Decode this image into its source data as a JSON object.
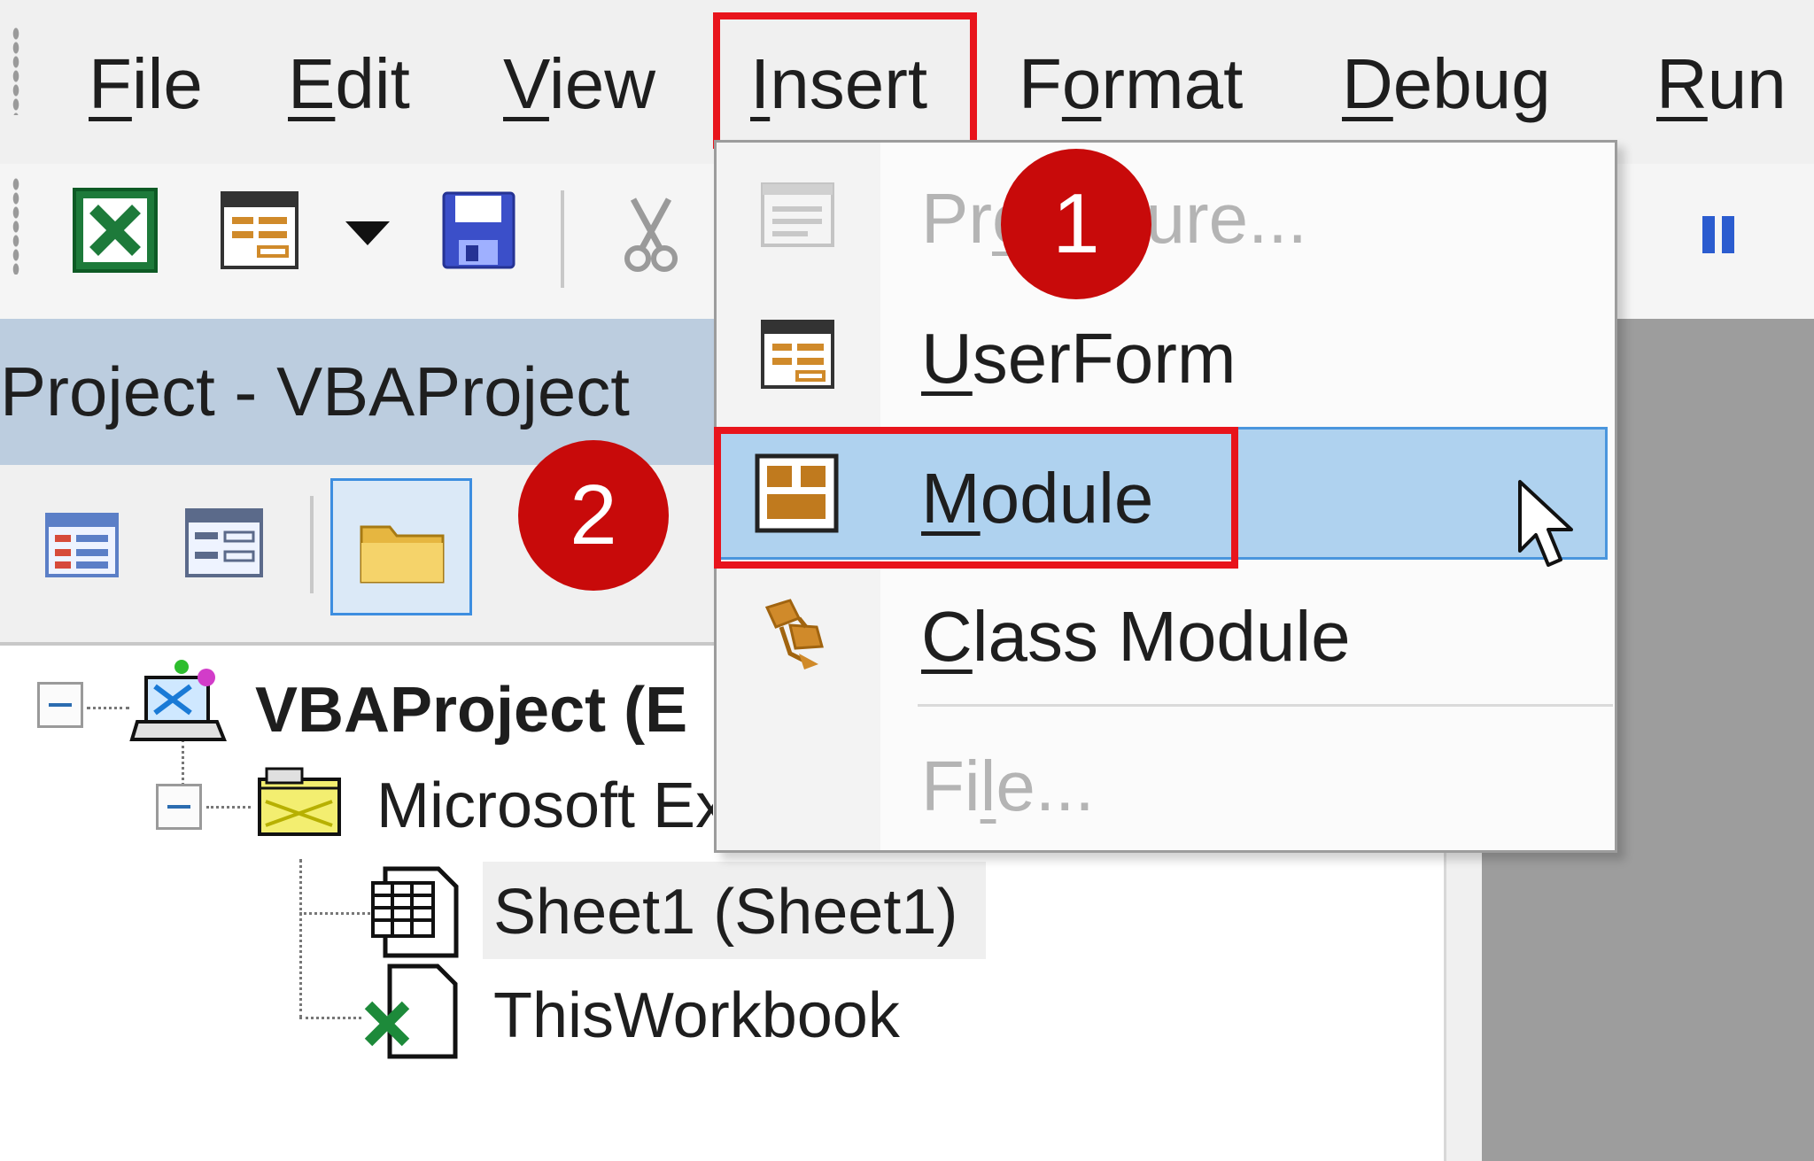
{
  "menubar": {
    "items": [
      {
        "prefix": "",
        "mnemonic": "F",
        "suffix": "ile"
      },
      {
        "prefix": "",
        "mnemonic": "E",
        "suffix": "dit"
      },
      {
        "prefix": "",
        "mnemonic": "V",
        "suffix": "iew"
      },
      {
        "prefix": "",
        "mnemonic": "I",
        "suffix": "nsert"
      },
      {
        "prefix": "F",
        "mnemonic": "o",
        "suffix": "rmat"
      },
      {
        "prefix": "",
        "mnemonic": "D",
        "suffix": "ebug"
      },
      {
        "prefix": "",
        "mnemonic": "R",
        "suffix": "un"
      }
    ]
  },
  "toolbar": {
    "icons": [
      "excel-icon",
      "userform-icon",
      "dropdown-arrow-icon",
      "save-icon",
      "cut-icon",
      "break-icon"
    ]
  },
  "project_explorer": {
    "title": "Project - VBAProject",
    "buttons": [
      "view-code-icon",
      "view-object-icon",
      "toggle-folders-icon"
    ],
    "tree": {
      "root": "VBAProject (E",
      "folder": "Microsoft Ex",
      "sheet": "Sheet1 (Sheet1)",
      "workbook": "ThisWorkbook"
    }
  },
  "insert_menu": {
    "items": [
      {
        "pre": "Pr",
        "mn": "o",
        "post": "cedure...",
        "visible": "Pro   ure...",
        "enabled": false
      },
      {
        "pre": "",
        "mn": "U",
        "post": "serForm",
        "enabled": true
      },
      {
        "pre": "",
        "mn": "M",
        "post": "odule",
        "enabled": true,
        "highlighted": true
      },
      {
        "pre": "",
        "mn": "C",
        "post": "lass Module",
        "enabled": true
      },
      {
        "pre": "Fi",
        "mn": "l",
        "post": "e...",
        "enabled": false
      }
    ]
  },
  "annotations": {
    "step1": "1",
    "step2": "2"
  },
  "colors": {
    "highlight": "#afd2ef",
    "highlight_border": "#4a96dd",
    "callout_red": "#e8141c",
    "step_badge": "#c80a0a",
    "title_bar": "#bccddf"
  }
}
